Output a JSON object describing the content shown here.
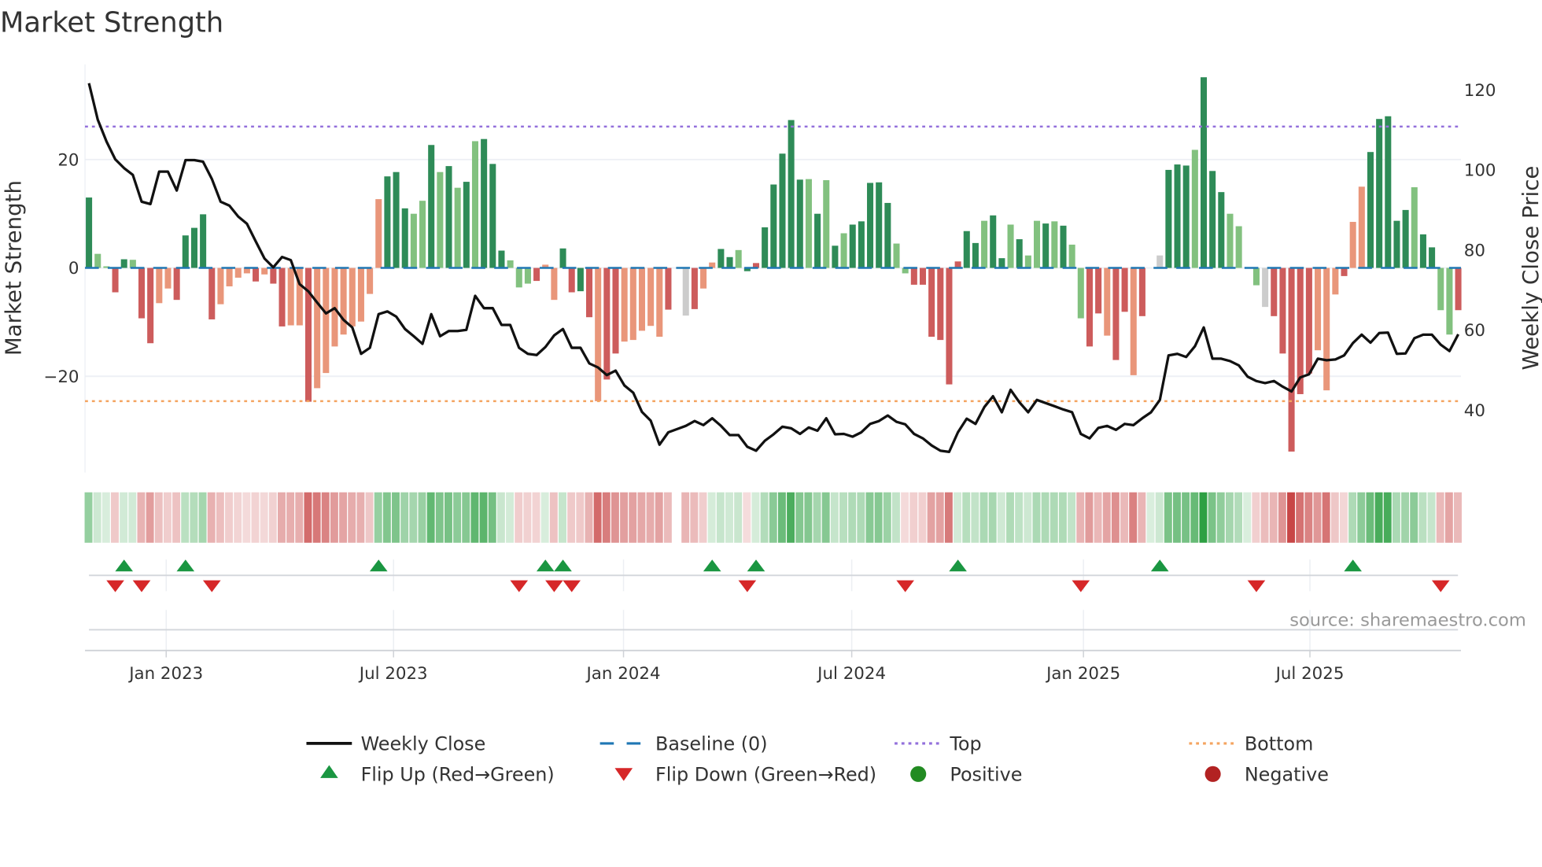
{
  "chart_data": {
    "type": "bar",
    "title": "Market Strength",
    "ylabel": "Market Strength",
    "y2label": "Weekly Close Price",
    "source": "source: sharemaestro.com",
    "ylim": [
      -38,
      38.5
    ],
    "y2lim": [
      25.5,
      126.5
    ],
    "yticks": [
      {
        "value": 20,
        "label": "20"
      },
      {
        "value": 0,
        "label": "0"
      },
      {
        "value": -20,
        "label": "−20"
      }
    ],
    "y2ticks": [
      {
        "value": 120,
        "label": "120"
      },
      {
        "value": 100,
        "label": "100"
      },
      {
        "value": 80,
        "label": "80"
      },
      {
        "value": 60,
        "label": "60"
      },
      {
        "value": 40,
        "label": "40"
      }
    ],
    "xticks": [
      {
        "week": 8.8,
        "label": "Jan 2023"
      },
      {
        "week": 34.7,
        "label": "Jul 2023"
      },
      {
        "week": 60.9,
        "label": "Jan 2024"
      },
      {
        "week": 86.9,
        "label": "Jul 2024"
      },
      {
        "week": 113.3,
        "label": "Jan 2025"
      },
      {
        "week": 139.1,
        "label": "Jul 2025"
      }
    ],
    "top_level": 26.1,
    "bottom_level": -24.6,
    "baseline": 0,
    "strength": [
      13,
      2.6,
      0.3,
      -4.5,
      1.6,
      1.5,
      -9.3,
      -13.9,
      -6.5,
      -3.8,
      -5.9,
      6,
      7.4,
      9.9,
      -9.5,
      -6.7,
      -3.4,
      -1.8,
      -1,
      -2.5,
      -1.2,
      -2.9,
      -10.8,
      -10.6,
      -10.6,
      -24.7,
      -22.2,
      -19.4,
      -14.5,
      -12.3,
      -10.8,
      -9.9,
      -4.8,
      12.7,
      16.9,
      17.7,
      11,
      10,
      12.4,
      22.7,
      17.7,
      18.8,
      14.8,
      15.9,
      23.4,
      23.8,
      19.2,
      3.2,
      1.4,
      -3.6,
      -2.9,
      -2.4,
      0.6,
      -5.9,
      3.6,
      -4.5,
      -4.3,
      -9.1,
      -24.6,
      -20.6,
      -15.8,
      -13.6,
      -13.3,
      -11.6,
      -10.7,
      -12.7,
      -7.7,
      null,
      -8.8,
      -7.6,
      -3.8,
      1,
      3.5,
      2,
      3.3,
      -0.6,
      0.9,
      7.5,
      15.4,
      21.1,
      27.3,
      16.3,
      16.4,
      10,
      16.2,
      4.1,
      6.4,
      8,
      8.6,
      15.7,
      15.8,
      12,
      4.5,
      -1,
      -3.1,
      -3.1,
      -12.7,
      -13.3,
      -21.5,
      1.2,
      6.8,
      4.6,
      8.7,
      9.7,
      1.8,
      8,
      5.3,
      2.3,
      8.7,
      8.2,
      8.6,
      7.8,
      4.3,
      -9.3,
      -14.5,
      -8.4,
      -12.5,
      -17,
      -8.1,
      -19.8,
      -8.9,
      0,
      2.3,
      18.1,
      19.1,
      18.9,
      21.8,
      35.2,
      17.9,
      14,
      10,
      7.7,
      0,
      -3.2,
      -7.2,
      -8.9,
      -15.8,
      -33.9,
      -23.3,
      -19.5,
      -15.2,
      -22.6,
      -4.9,
      -1.5,
      8.5,
      15,
      21.4,
      27.5,
      28,
      8.7,
      10.7,
      14.9,
      6.2,
      3.8,
      -7.8,
      -12.3,
      -7.8
    ],
    "tone": "dllrdlrrssrdddrssssrsrrssrssssssssdddlldldldldddlllrssdrdrsrrsssssrs-rssddldrdddddldldldddddllrrrrrrddlddldlldldllrrsrrsrs-dddldddllll-rrrrrsssrssdddddlddllrrs",
    "weekly_close": [
      121.7,
      112.6,
      107.1,
      102.7,
      100.5,
      98.8,
      92.1,
      91.5,
      99.6,
      99.6,
      94.9,
      102.5,
      102.5,
      102.1,
      97.8,
      92.1,
      91.1,
      88.4,
      86.6,
      82.2,
      77.9,
      75.7,
      78.3,
      77.5,
      71.5,
      69.7,
      66.9,
      64.2,
      65.5,
      62.6,
      60.7,
      54.1,
      55.6,
      64.0,
      64.7,
      63.4,
      60.3,
      58.5,
      56.6,
      64.0,
      58.5,
      59.8,
      59.8,
      60.1,
      68.6,
      65.5,
      65.5,
      61.3,
      61.3,
      55.6,
      54.1,
      53.8,
      55.8,
      58.7,
      60.3,
      55.6,
      55.6,
      51.7,
      50.7,
      48.8,
      49.9,
      46.2,
      44.4,
      39.6,
      37.4,
      31.4,
      34.5,
      35.3,
      36.1,
      37.3,
      36.3,
      38.0,
      36.1,
      33.8,
      33.8,
      30.9,
      29.9,
      32.4,
      34.0,
      35.9,
      35.5,
      34.1,
      35.7,
      34.9,
      38.0,
      34.0,
      34.1,
      33.4,
      34.5,
      36.6,
      37.3,
      38.7,
      37.1,
      36.5,
      34.1,
      33.0,
      31.2,
      29.9,
      29.6,
      34.5,
      37.9,
      36.6,
      40.8,
      43.5,
      39.5,
      45.1,
      42.0,
      39.5,
      42.6,
      41.8,
      41.0,
      40.2,
      39.5,
      34.1,
      33.0,
      35.6,
      36.1,
      35.1,
      36.6,
      36.3,
      38.0,
      39.5,
      42.6,
      53.7,
      54.1,
      53.3,
      56.0,
      60.7,
      52.9,
      52.9,
      52.3,
      51.2,
      48.4,
      47.3,
      46.8,
      47.3,
      45.9,
      44.7,
      48.2,
      49.0,
      52.9,
      52.5,
      52.7,
      53.7,
      56.8,
      58.9,
      56.9,
      59.3,
      59.4,
      54.1,
      54.2,
      58.0,
      58.9,
      58.9,
      56.4,
      54.8,
      59.0
    ],
    "flips_up": [
      4,
      11,
      33,
      52,
      54,
      71,
      76,
      99,
      122,
      144
    ],
    "flips_down": [
      3,
      6,
      14,
      49,
      53,
      55,
      75,
      93,
      113,
      133,
      154
    ],
    "legend": {
      "placement": "bottom",
      "items": [
        {
          "key": "weekly_close",
          "label": "Weekly Close"
        },
        {
          "key": "baseline",
          "label": "Baseline (0)"
        },
        {
          "key": "top",
          "label": "Top"
        },
        {
          "key": "bottom",
          "label": "Bottom"
        },
        {
          "key": "flip_up",
          "label": "Flip Up (Red→Green)"
        },
        {
          "key": "flip_down",
          "label": "Flip Down (Green→Red)"
        },
        {
          "key": "positive",
          "label": "Positive"
        },
        {
          "key": "negative",
          "label": "Negative"
        }
      ]
    },
    "colors": {
      "strong_pos": "#2e8b57",
      "weak_pos": "#82c17f",
      "strong_neg": "#cd5c5c",
      "weak_neg": "#e9967a",
      "close": "#111111",
      "baseline": "#1f77b4",
      "top": "#9370db",
      "bottom": "#f4a460",
      "flip_up": "#1a9641",
      "flip_down": "#d62728",
      "positive": "#228b22",
      "negative": "#b22222"
    }
  }
}
